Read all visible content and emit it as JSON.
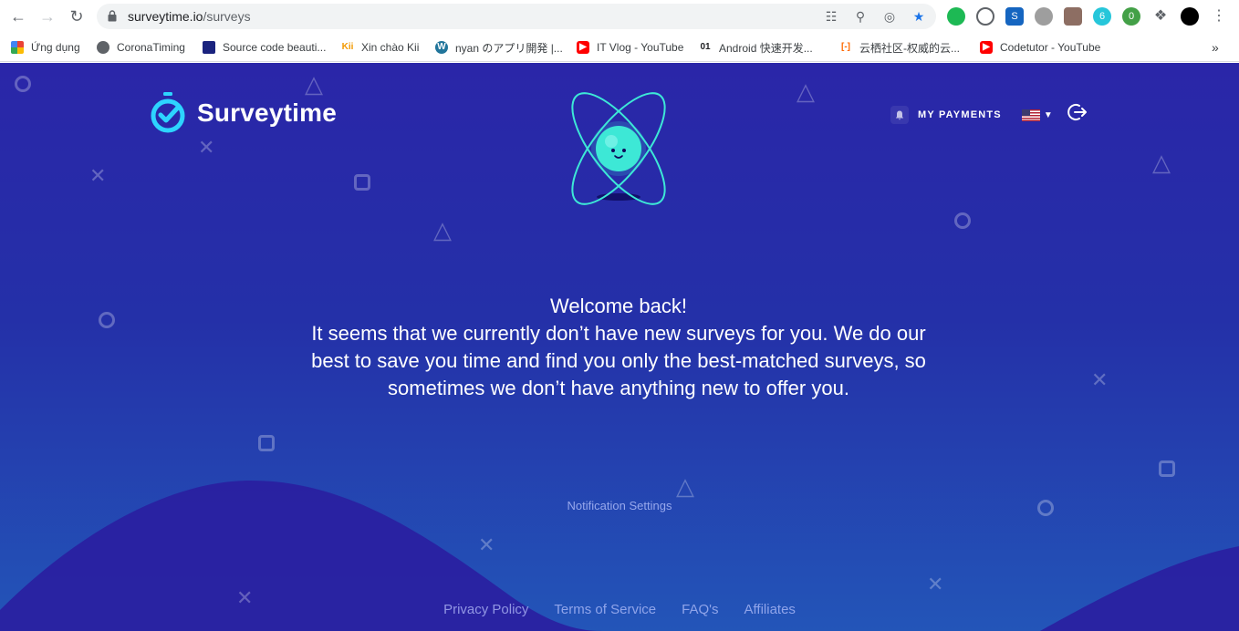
{
  "browser": {
    "url_host": "surveytime.io",
    "url_path": "/surveys",
    "bookmarks": [
      {
        "label": "Ứng dụng",
        "icon": "apps-grid-icon",
        "color": "#4285f4"
      },
      {
        "label": "CoronaTiming",
        "icon": "globe-icon",
        "color": "#5f6368"
      },
      {
        "label": "Source code beauti...",
        "icon": "source-icon",
        "color": "#1a237e"
      },
      {
        "label": "Xin chào Kii",
        "icon": "kii-icon",
        "color": "#f29900"
      },
      {
        "label": "nyan のアプリ開発 |...",
        "icon": "wordpress-icon",
        "color": "#21759b"
      },
      {
        "label": "IT Vlog - YouTube",
        "icon": "youtube-icon",
        "color": "#ff0000"
      },
      {
        "label": "Android 快速开发...",
        "icon": "01-icon",
        "color": "#202124"
      },
      {
        "label": "云栖社区-权威的云...",
        "icon": "aliyun-icon",
        "color": "#ff6a00"
      },
      {
        "label": "Codetutor - YouTube",
        "icon": "youtube-icon",
        "color": "#ff0000"
      }
    ]
  },
  "header": {
    "logo_text": "Surveytime",
    "payments_label": "MY PAYMENTS"
  },
  "main": {
    "welcome": "Welcome back!",
    "message": "It seems that we currently don’t have new surveys for you. We do our best to save you time and find you only the best-matched surveys, so sometimes we don’t have anything new to offer you.",
    "notification_settings": "Notification Settings"
  },
  "footer": {
    "links": [
      "Privacy Policy",
      "Terms of Service",
      "FAQ's",
      "Affiliates"
    ]
  },
  "colors": {
    "accent": "#2dd4ff",
    "mascot": "#3de8d6",
    "bg_top": "#2a26a8",
    "bg_bottom": "#2355b8"
  }
}
